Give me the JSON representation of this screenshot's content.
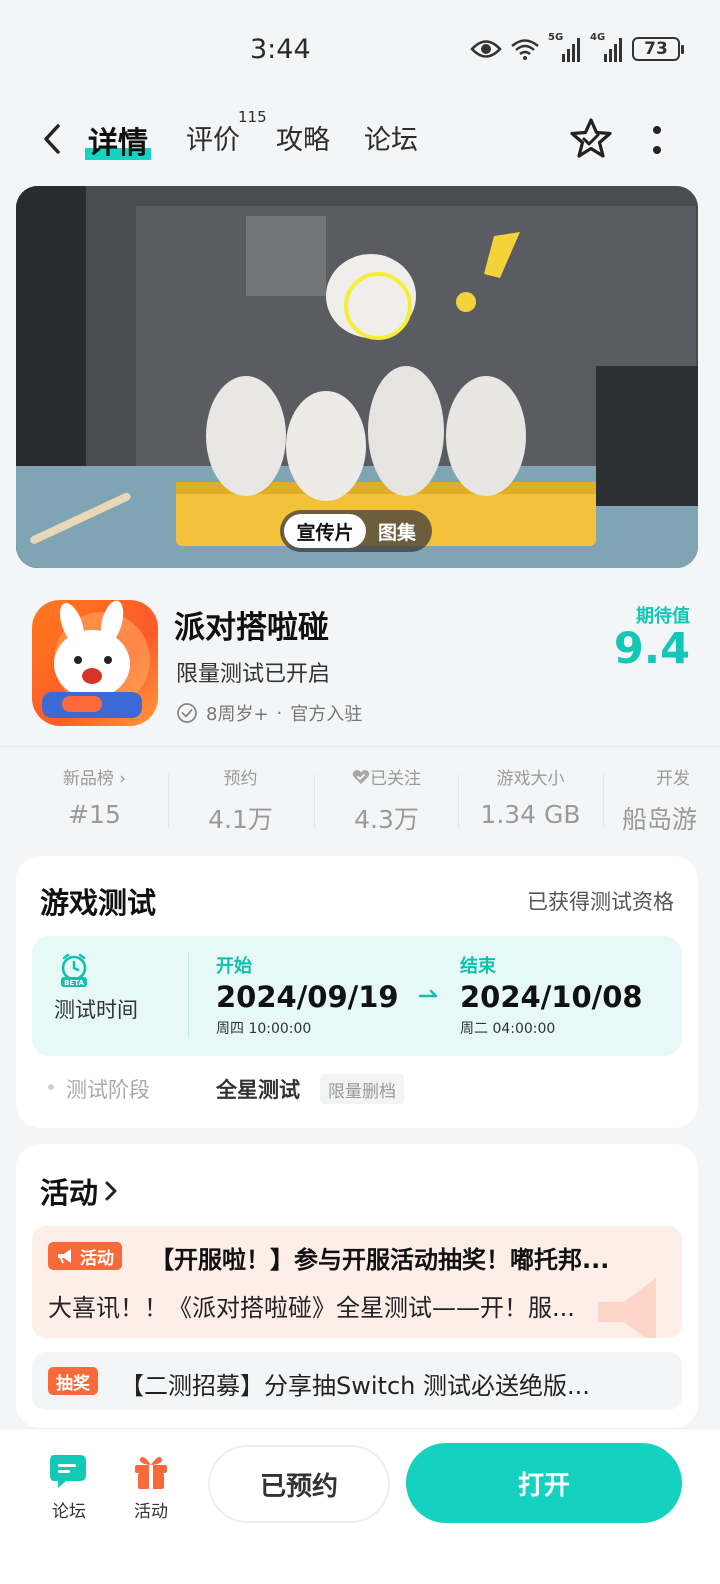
{
  "status": {
    "time": "3:44",
    "battery": "73",
    "net1": "5G",
    "net2": "4G"
  },
  "nav": {
    "tabs": [
      {
        "label": "详情"
      },
      {
        "label": "评价",
        "badge": "115"
      },
      {
        "label": "攻略"
      },
      {
        "label": "论坛"
      }
    ]
  },
  "banner": {
    "video_label": "宣传片",
    "gallery_label": "图集"
  },
  "app": {
    "name": "派对搭啦碰",
    "subtitle": "限量测试已开启",
    "age": "8周岁+",
    "official": "官方入驻",
    "score_label": "期待值",
    "score": "9.4"
  },
  "stats": [
    {
      "label": "新品榜 ›",
      "value": "#15"
    },
    {
      "label": "预约",
      "value": "4.1万"
    },
    {
      "label": "已关注",
      "value": "4.3万"
    },
    {
      "label": "游戏大小",
      "value": "1.34 GB"
    },
    {
      "label": "开发",
      "value": "船岛游"
    }
  ],
  "test": {
    "title": "游戏测试",
    "qualification": "已获得测试资格",
    "time_label": "测试时间",
    "start_tag": "开始",
    "start_date": "2024/09/19",
    "start_sub": "周四  10:00:00",
    "end_tag": "结束",
    "end_date": "2024/10/08",
    "end_sub": "周二  04:00:00",
    "phase_label": "测试阶段",
    "phase_value": "全星测试",
    "phase_tag": "限量删档"
  },
  "activity": {
    "title": "活动",
    "item1": {
      "tag": "活动",
      "title": "【开服啦！】参与开服活动抽奖！嘟托邦...",
      "desc": "大喜讯！！《派对搭啦碰》全星测试——开！服..."
    },
    "item2": {
      "tag": "抽奖",
      "title": "【二测招募】分享抽Switch 测试必送绝版..."
    }
  },
  "bottom": {
    "forum_label": "论坛",
    "activity_label": "活动",
    "reserved_label": "已预约",
    "open_label": "打开"
  },
  "colors": {
    "accent": "#14d2bf",
    "activity_tag": "#f86a3a"
  }
}
